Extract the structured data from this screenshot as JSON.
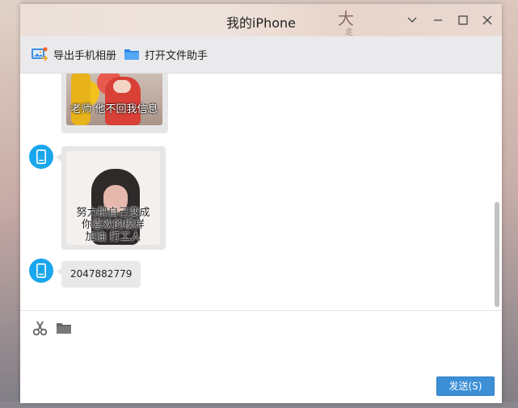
{
  "window": {
    "title": "我的iPhone"
  },
  "toolbar": {
    "export_label": "导出手机相册",
    "open_label": "打开文件助手"
  },
  "messages": [
    {
      "type": "image",
      "caption": "老师 他不回我信息"
    },
    {
      "type": "image",
      "caption_lines": [
        "努力把自己变成",
        "你喜欢的模样",
        "加油 打工人"
      ]
    },
    {
      "type": "text",
      "text": "2047882779"
    }
  ],
  "composer": {
    "send_label": "发送(S)"
  },
  "colors": {
    "accent": "#3d8fd6",
    "avatar": "#1aa6ec"
  }
}
